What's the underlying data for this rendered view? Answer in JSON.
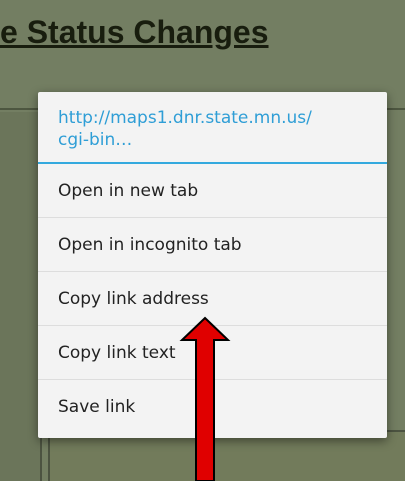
{
  "page": {
    "title": "e Status Changes"
  },
  "context_menu": {
    "url_line1": "http://maps1.dnr.state.mn.us/",
    "url_line2": "cgi-bin…",
    "items": [
      {
        "label": "Open in new tab"
      },
      {
        "label": "Open in incognito tab"
      },
      {
        "label": "Copy link address"
      },
      {
        "label": "Copy link text"
      },
      {
        "label": "Save link"
      }
    ]
  },
  "colors": {
    "page_background": "#8d9a78",
    "link_blue": "#2f9ed6",
    "annotation_arrow": "#e00000"
  }
}
